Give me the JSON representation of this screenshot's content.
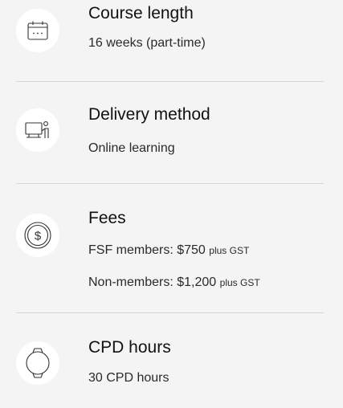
{
  "items": [
    {
      "icon": "calendar-icon",
      "title": "Course length",
      "lines": [
        {
          "text": "16 weeks (part-time)",
          "suffix": ""
        }
      ]
    },
    {
      "icon": "presentation-icon",
      "title": "Delivery method",
      "lines": [
        {
          "text": "Online learning",
          "suffix": ""
        }
      ]
    },
    {
      "icon": "dollar-coin-icon",
      "title": "Fees",
      "lines": [
        {
          "text": "FSF members: $750",
          "suffix": "plus GST"
        },
        {
          "text": "Non-members: $1,200",
          "suffix": "plus GST"
        }
      ]
    },
    {
      "icon": "watch-icon",
      "title": "CPD hours",
      "lines": [
        {
          "text": "30 CPD hours",
          "suffix": ""
        }
      ]
    }
  ]
}
